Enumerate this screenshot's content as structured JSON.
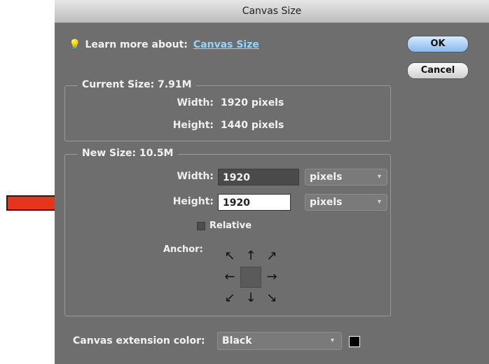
{
  "window": {
    "title": "Canvas Size"
  },
  "learn_more": {
    "prefix": "Learn more about:",
    "link": "Canvas Size"
  },
  "buttons": {
    "ok": "OK",
    "cancel": "Cancel"
  },
  "current_size": {
    "title": "Current Size: 7.91M",
    "width_label": "Width:",
    "width_value": "1920 pixels",
    "height_label": "Height:",
    "height_value": "1440 pixels"
  },
  "new_size": {
    "title": "New Size: 10.5M",
    "width_label": "Width:",
    "width_value": "1920",
    "width_unit": "pixels",
    "height_label": "Height:",
    "height_value": "1920",
    "height_unit": "pixels",
    "relative_label": "Relative",
    "relative_checked": false,
    "anchor_label": "Anchor:"
  },
  "extension": {
    "label": "Canvas extension color:",
    "value": "Black",
    "swatch_color": "#000000"
  },
  "annotation": {
    "arrow_color": "#e8341c",
    "icon": "red-arrow-pointing-right"
  }
}
